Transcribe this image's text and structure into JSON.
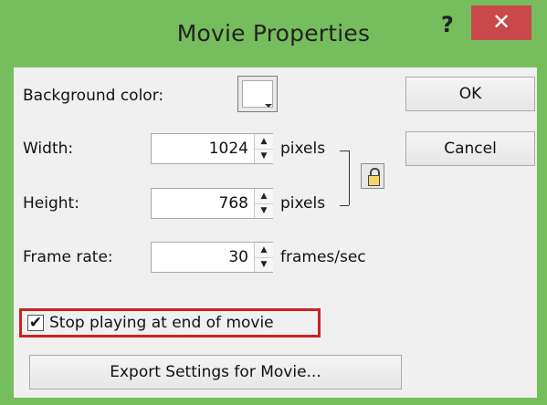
{
  "window": {
    "title": "Movie Properties",
    "help_label": "?",
    "close_label": "✕"
  },
  "background": {
    "label": "Background color:",
    "color": "#ffffff"
  },
  "width": {
    "label": "Width:",
    "value": "1024",
    "unit": "pixels"
  },
  "height": {
    "label": "Height:",
    "value": "768",
    "unit": "pixels"
  },
  "frame_rate": {
    "label": "Frame rate:",
    "value": "30",
    "unit": "frames/sec"
  },
  "stop_playing": {
    "label": "Stop playing at end of movie",
    "checked": true,
    "check_glyph": "✔"
  },
  "buttons": {
    "ok": "OK",
    "cancel": "Cancel",
    "export": "Export Settings for Movie..."
  },
  "icons": {
    "spin_up": "▲",
    "spin_down": "▼"
  },
  "colors": {
    "titlebar": "#76bd5e",
    "close": "#c9484a",
    "highlight": "#cc2222"
  }
}
